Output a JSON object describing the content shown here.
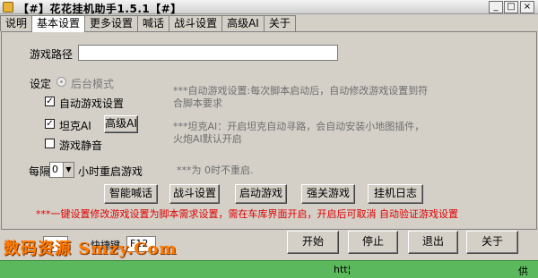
{
  "window": {
    "title": "【#】花花挂机助手1.5.1【#】",
    "min_label": "_",
    "max_label": "□",
    "close_label": "×"
  },
  "tabs": [
    {
      "label": "说明"
    },
    {
      "label": "基本设置",
      "active": true
    },
    {
      "label": "更多设置"
    },
    {
      "label": "喊话"
    },
    {
      "label": "战斗设置"
    },
    {
      "label": "高级AI"
    },
    {
      "label": "关于"
    }
  ],
  "settings": {
    "game_path_label": "游戏路径",
    "game_path_value": "",
    "setting_label": "设定",
    "background_mode_label": "后台模式",
    "auto_game_setting_label": "自动游戏设置",
    "auto_game_setting_checked": true,
    "auto_game_setting_note": "***自动游戏设置:每次脚本启动后，自动修改游戏设置到符合脚本要求",
    "tank_ai_label": "坦克AI",
    "tank_ai_checked": true,
    "advanced_ai_button": "高级AI",
    "tank_ai_note": "***坦克AI：开启坦克自动寻路，会自动安装小地图插件，火炮AI默认开启",
    "mute_label": "游戏静音",
    "mute_checked": false,
    "every_label": "每隔",
    "restart_hours_value": "0",
    "restart_hours_suffix": "小时重启游戏",
    "restart_note": "***为 0时不重启."
  },
  "actions": {
    "smart_shout": "智能喊话",
    "battle_settings": "战斗设置",
    "launch_game": "启动游戏",
    "force_close": "强关游戏",
    "hangup_log": "挂机日志"
  },
  "warning_text": "***一键设置修改游戏设置为脚本需求设置，需在车库界面开启，开启后可取消 自动验证游戏设置",
  "bottom": {
    "start_key_value": "",
    "hotkey_label": "快捷键",
    "hotkey_value": "F12",
    "start_button": "开始",
    "stop_button": "停止",
    "exit_button": "退出",
    "about_button": "关于",
    "watermark": "数码资源 Smzy.Com"
  },
  "statusbar": {
    "url": "htt¦",
    "right": "供"
  },
  "colors": {
    "statusbar_bg": "#5cb85c",
    "warning_red": "#e00000",
    "watermark_orange": "#ff7a00"
  }
}
